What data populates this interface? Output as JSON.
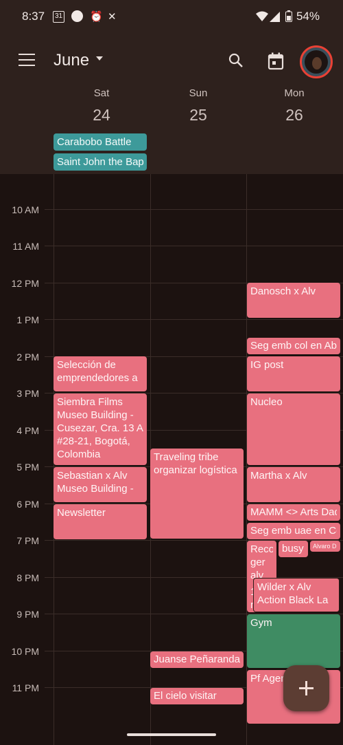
{
  "status_bar": {
    "time": "8:37",
    "battery": "54%",
    "icons": [
      "calendar-31-icon",
      "circle-icon",
      "alarm-icon",
      "sync-off-icon",
      "wifi-icon",
      "signal-icon",
      "battery-icon"
    ],
    "calendar_badge": "31"
  },
  "header": {
    "month": "June",
    "days": [
      {
        "dow": "Sat",
        "date": "24"
      },
      {
        "dow": "Sun",
        "date": "25"
      },
      {
        "dow": "Mon",
        "date": "26"
      }
    ],
    "allday_events": [
      {
        "title": "Carabobo Battle"
      },
      {
        "title": "Saint John the Bap"
      }
    ]
  },
  "hours": [
    "10 AM",
    "11 AM",
    "12 PM",
    "1 PM",
    "2 PM",
    "3 PM",
    "4 PM",
    "5 PM",
    "6 PM",
    "7 PM",
    "8 PM",
    "9 PM",
    "10 PM",
    "11 PM"
  ],
  "events": {
    "sat": [
      {
        "l1": "Selección de",
        "l2": "emprendedores a"
      },
      {
        "l1": "Siembra Films",
        "l2": "Museo Building -",
        "l3": "Cusezar, Cra. 13 A",
        "l4": "#28-21, Bogotá,",
        "l5": "Colombia"
      },
      {
        "l1": "Sebastian x Alv",
        "l2": "Museo Building -"
      },
      {
        "l1": "Newsletter"
      }
    ],
    "sun": [
      {
        "l1": "Traveling tribe",
        "l2": "organizar logística"
      },
      {
        "l1": "Juanse Peñaranda"
      },
      {
        "l1": "El cielo visitar"
      }
    ],
    "mon": [
      {
        "l1": "Danosch x Alv"
      },
      {
        "l1": "Seg emb col en Ab"
      },
      {
        "l1": "IG post"
      },
      {
        "l1": "Nucleo"
      },
      {
        "l1": "Martha x Alv"
      },
      {
        "l1": "MAMM <> Arts Dad"
      },
      {
        "l1": "Seg emb uae en Co"
      },
      {
        "l1": "Reco",
        "l2": "ger",
        "l3": "alv"
      },
      {
        "l1": "busy"
      },
      {
        "l1": "Alvaro D"
      },
      {
        "l1": "1",
        "l2": "n"
      },
      {
        "l1": "Wilder x Alv",
        "l2": "Action Black La"
      },
      {
        "l1": "Gym"
      },
      {
        "l1": "Pf Agen"
      }
    ]
  },
  "colors": {
    "event": "#e8707f",
    "allday": "#3d9a9a",
    "gym": "#3f8c63",
    "header_bg": "#2e211d",
    "body_bg": "#1c1210"
  }
}
